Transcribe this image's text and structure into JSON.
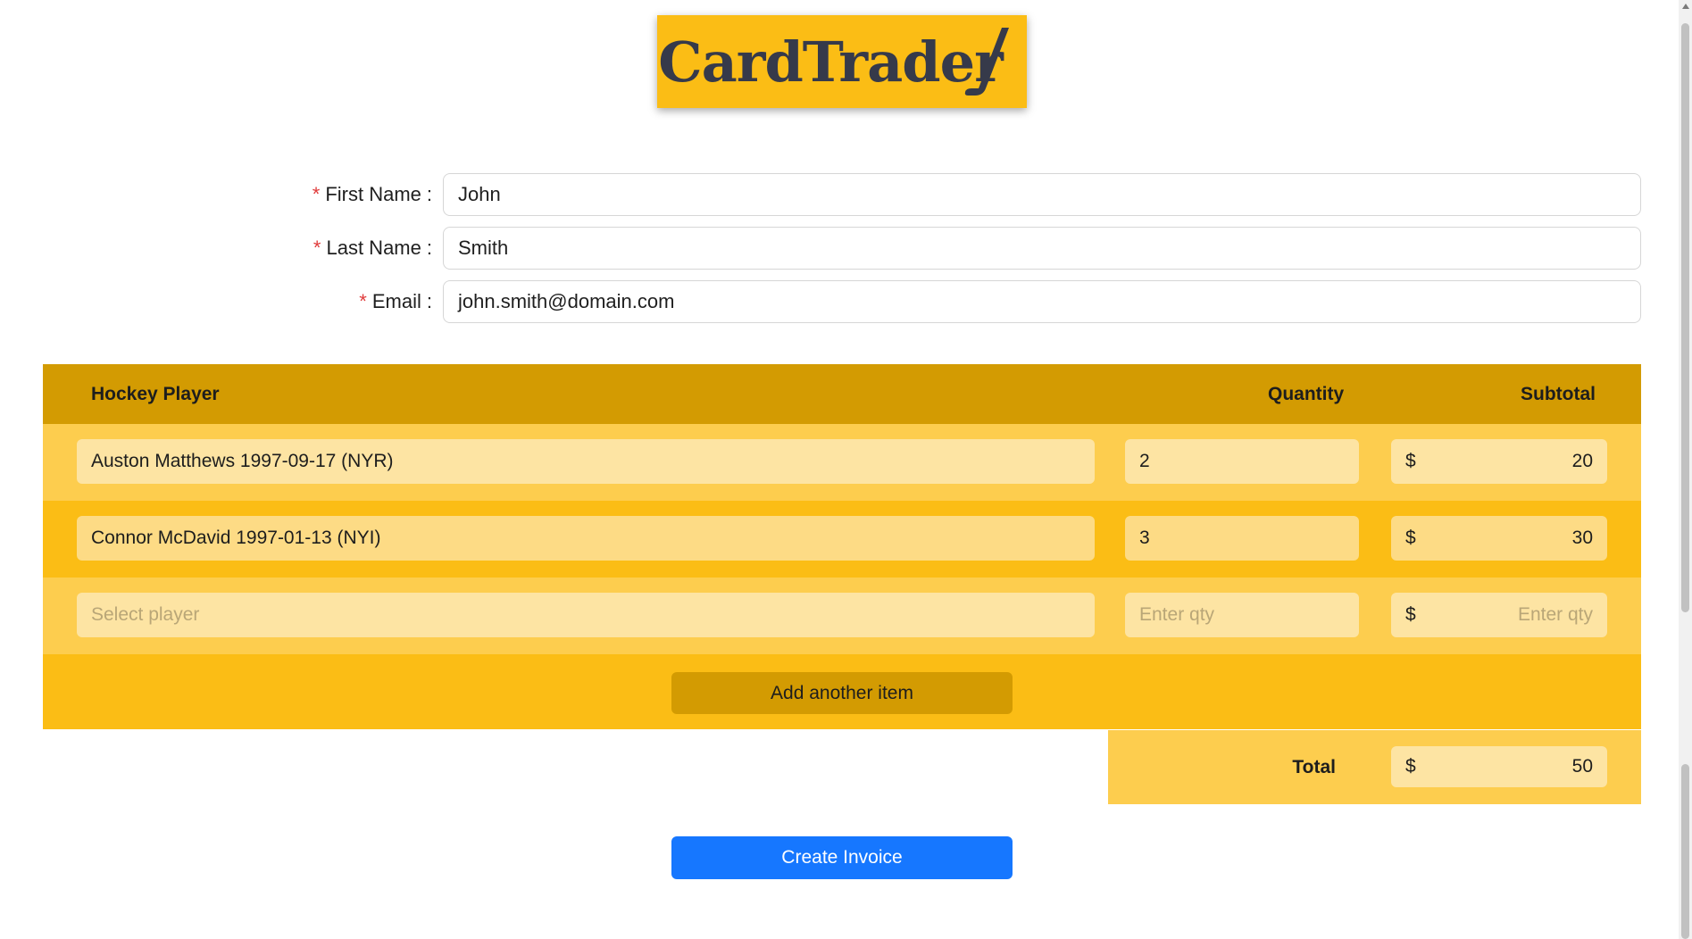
{
  "logo": {
    "text": "CardTrader",
    "icon": "hockey-stick-icon"
  },
  "form": {
    "first_name": {
      "label": "First Name",
      "value": "John"
    },
    "last_name": {
      "label": "Last Name",
      "value": "Smith"
    },
    "email": {
      "label": "Email",
      "value": "john.smith@domain.com"
    },
    "required_marker": "*",
    "separator": ":"
  },
  "table": {
    "headers": {
      "player": "Hockey Player",
      "quantity": "Quantity",
      "subtotal": "Subtotal"
    },
    "currency": "$",
    "rows": [
      {
        "player": "Auston Matthews 1997-09-17 (NYR)",
        "quantity": "2",
        "subtotal": "20"
      },
      {
        "player": "Connor McDavid 1997-01-13 (NYI)",
        "quantity": "3",
        "subtotal": "30"
      }
    ],
    "empty_row": {
      "player_placeholder": "Select player",
      "quantity_placeholder": "Enter qty",
      "subtotal_placeholder": "Enter qty"
    },
    "add_button": "Add another item"
  },
  "total": {
    "label": "Total",
    "value": "50"
  },
  "actions": {
    "create_invoice": "Create Invoice"
  },
  "colors": {
    "header": "#d39b02",
    "row_light": "#fdcd4e",
    "row_dark": "#fbbd15",
    "primary": "#1677ff",
    "required": "#e03b3b"
  }
}
